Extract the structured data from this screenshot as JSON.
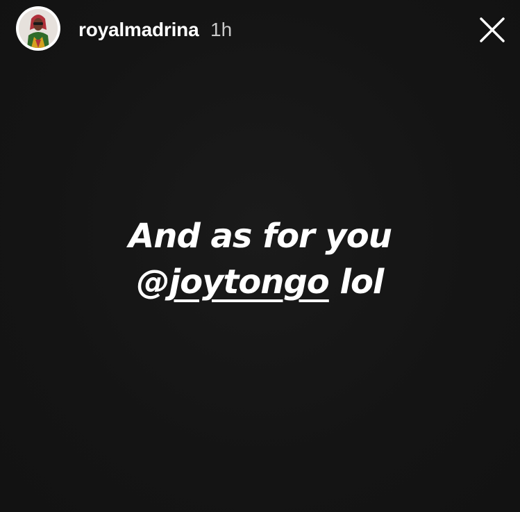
{
  "story": {
    "background_color": "#141414",
    "header": {
      "username": "royalmadrina",
      "timestamp": "1h",
      "avatar_icon": "profile-photo",
      "close_icon": "close-x-icon"
    },
    "caption": {
      "line1": "And as for you",
      "line2_at": "@",
      "mention_handle": "joytongo",
      "line2_suffix": " lol"
    }
  }
}
